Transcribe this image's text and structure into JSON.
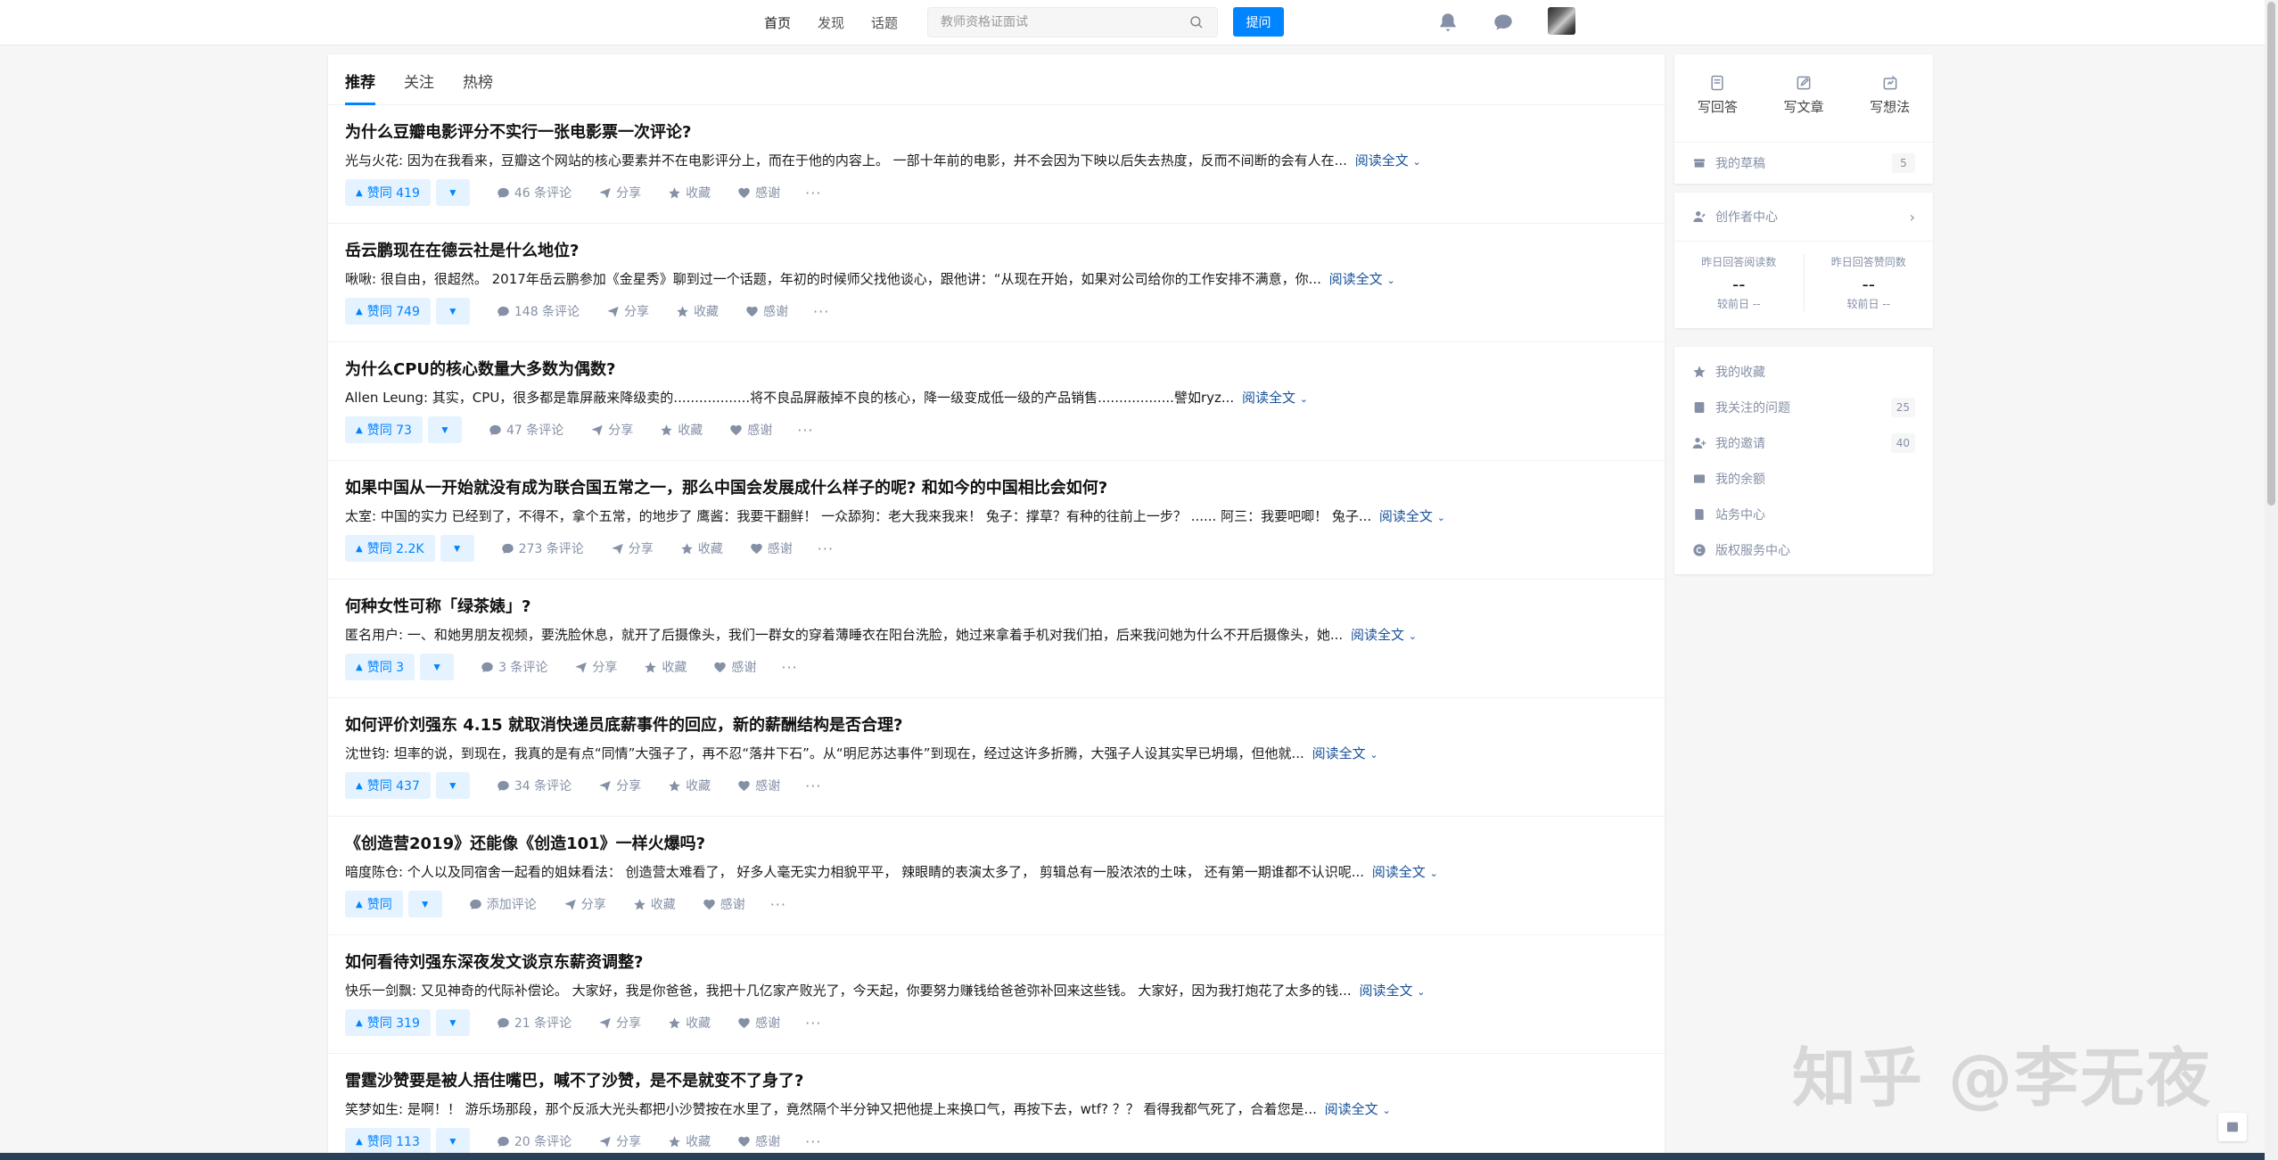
{
  "header": {
    "nav": [
      "首页",
      "发现",
      "话题"
    ],
    "search_placeholder": "教师资格证面试",
    "ask_label": "提问"
  },
  "feed": {
    "tabs": [
      "推荐",
      "关注",
      "热榜"
    ],
    "items": [
      {
        "title": "为什么豆瓣电影评分不实行一张电影票一次评论?",
        "author": "光与火花:",
        "excerpt": "因为在我看来，豆瓣这个网站的核心要素并不在电影评分上，而在于他的内容上。 一部十年前的电影，并不会因为下映以后失去热度，反而不间断的会有人在...",
        "vote": "赞同 419",
        "comments": "46 条评论"
      },
      {
        "title": "岳云鹏现在在德云社是什么地位?",
        "author": "啾啾:",
        "excerpt": "很自由，很超然。 2017年岳云鹏参加《金星秀》聊到过一个话题，年初的时候师父找他谈心，跟他讲：“从现在开始，如果对公司给你的工作安排不满意，你...",
        "vote": "赞同 749",
        "comments": "148 条评论"
      },
      {
        "title": "为什么CPU的核心数量大多数为偶数?",
        "author": "Allen Leung:",
        "excerpt": "其实，CPU，很多都是靠屏蔽来降级卖的..................将不良品屏蔽掉不良的核心，降一级变成低一级的产品销售..................譬如ryz...",
        "vote": "赞同 73",
        "comments": "47 条评论"
      },
      {
        "title": "如果中国从一开始就没有成为联合国五常之一，那么中国会发展成什么样子的呢? 和如今的中国相比会如何?",
        "author": "太室:",
        "excerpt": "中国的实力 已经到了，不得不，拿个五常，的地步了 鹰酱：我要干翻鲜！ 一众舔狗：老大我来我来！ 兔子：撑草？有种的往前上一步？ ...... 阿三：我要吧唧！ 兔子...",
        "vote": "赞同 2.2K",
        "comments": "273 条评论"
      },
      {
        "title": "何种女性可称「绿茶婊」?",
        "author": "匿名用户:",
        "excerpt": "一、和她男朋友视频，要洗脸休息，就开了后摄像头，我们一群女的穿着薄睡衣在阳台洗脸，她过来拿着手机对我们拍，后来我问她为什么不开后摄像头，她...",
        "vote": "赞同 3",
        "comments": "3 条评论"
      },
      {
        "title": "如何评价刘强东 4.15 就取消快递员底薪事件的回应，新的薪酬结构是否合理?",
        "author": "沈世钧:",
        "excerpt": "坦率的说，到现在，我真的是有点“同情”大强子了，再不忍“落井下石”。从“明尼苏达事件”到现在，经过这许多折腾，大强子人设其实早已坍塌，但他就...",
        "vote": "赞同 437",
        "comments": "34 条评论"
      },
      {
        "title": "《创造营2019》还能像《创造101》一样火爆吗?",
        "author": "暗度陈仓:",
        "excerpt": "个人以及同宿舍一起看的姐妹看法： 创造营太难看了， 好多人毫无实力相貌平平， 辣眼睛的表演太多了， 剪辑总有一股浓浓的土味， 还有第一期谁都不认识呢...",
        "vote": "赞同",
        "comments": "添加评论"
      },
      {
        "title": "如何看待刘强东深夜发文谈京东薪资调整?",
        "author": "快乐一剑飘:",
        "excerpt": "又见神奇的代际补偿论。 大家好，我是你爸爸，我把十几亿家产败光了，今天起，你要努力赚钱给爸爸弥补回来这些钱。 大家好，因为我打炮花了太多的钱...",
        "vote": "赞同 319",
        "comments": "21 条评论"
      },
      {
        "title": "雷霆沙赞要是被人捂住嘴巴，喊不了沙赞，是不是就变不了身了?",
        "author": "笑梦如生:",
        "excerpt": "是啊！！ 游乐场那段，那个反派大光头都把小沙赞按在水里了，竟然隔个半分钟又把他提上来换口气，再按下去，wtf? ？？ 看得我都气死了，合着您是...",
        "vote": "赞同 113",
        "comments": "20 条评论"
      }
    ],
    "labels": {
      "read_more": "阅读全文",
      "share": "分享",
      "collect": "收藏",
      "thanks": "感谢",
      "more": "···"
    }
  },
  "sidebar": {
    "quick": [
      "写回答",
      "写文章",
      "写想法"
    ],
    "drafts": {
      "label": "我的草稿",
      "count": "5"
    },
    "creator": {
      "title": "创作者中心",
      "stat1_label": "昨日回答阅读数",
      "stat1_value": "--",
      "stat1_cmp": "较前日  --",
      "stat2_label": "昨日回答赞同数",
      "stat2_value": "--",
      "stat2_cmp": "较前日  --"
    },
    "list": [
      {
        "label": "我的收藏",
        "count": ""
      },
      {
        "label": "我关注的问题",
        "count": "25"
      },
      {
        "label": "我的邀请",
        "count": "40"
      },
      {
        "label": "我的余额",
        "count": ""
      },
      {
        "label": "站务中心",
        "count": ""
      },
      {
        "label": "版权服务中心",
        "count": ""
      }
    ]
  },
  "watermark": "知乎 @李无夜"
}
